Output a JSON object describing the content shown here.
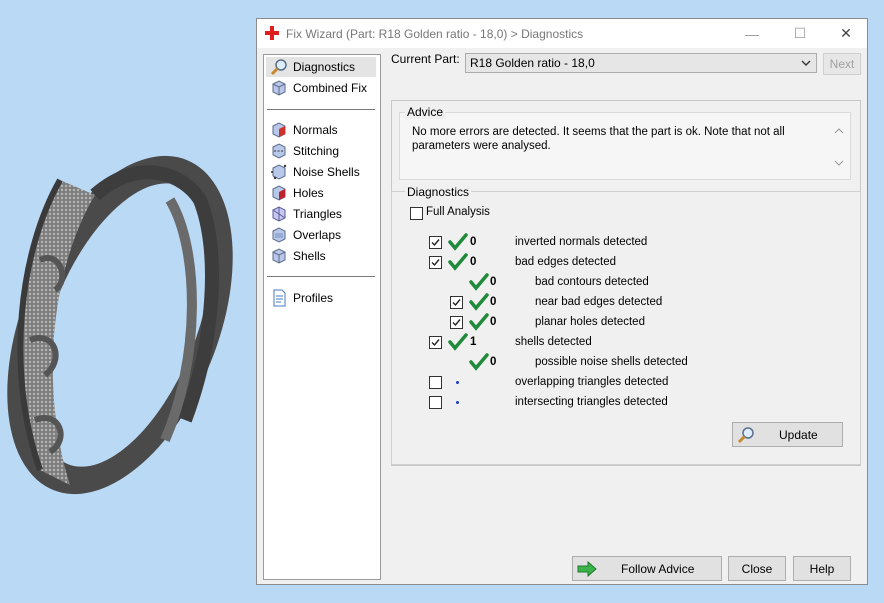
{
  "window": {
    "title": "Fix Wizard (Part: R18 Golden ratio - 18,0) > Diagnostics",
    "minimize": "—",
    "maximize": "☐",
    "close": "✕"
  },
  "sidebar": {
    "items": [
      {
        "label": "Diagnostics",
        "icon": "magnifier-icon"
      },
      {
        "label": "Combined Fix",
        "icon": "cube-icon"
      },
      {
        "label": "Normals",
        "icon": "normals-cube-icon"
      },
      {
        "label": "Stitching",
        "icon": "stitching-cube-icon"
      },
      {
        "label": "Noise Shells",
        "icon": "noise-shells-cube-icon"
      },
      {
        "label": "Holes",
        "icon": "holes-cube-icon"
      },
      {
        "label": "Triangles",
        "icon": "triangles-cube-icon"
      },
      {
        "label": "Overlaps",
        "icon": "overlaps-cube-icon"
      },
      {
        "label": "Shells",
        "icon": "shells-cube-icon"
      },
      {
        "label": "Profiles",
        "icon": "document-icon"
      }
    ]
  },
  "current_part": {
    "label": "Current Part:",
    "value": "R18 Golden ratio - 18,0",
    "next_label": "Next"
  },
  "advice": {
    "title": "Advice",
    "text": "No more errors are detected. It seems that the part is ok. Note that not all parameters were analysed."
  },
  "diagnostics": {
    "title": "Diagnostics",
    "full_analysis_label": "Full Analysis",
    "full_analysis_checked": false,
    "rows": [
      {
        "checkbox": true,
        "checked": true,
        "status": "ok",
        "count": "0",
        "text": "inverted normals detected",
        "indent": 0
      },
      {
        "checkbox": true,
        "checked": true,
        "status": "ok",
        "count": "0",
        "text": "bad edges detected",
        "indent": 0
      },
      {
        "checkbox": false,
        "checked": false,
        "status": "ok",
        "count": "0",
        "text": "bad contours detected",
        "indent": 1
      },
      {
        "checkbox": true,
        "checked": true,
        "status": "ok",
        "count": "0",
        "text": "near bad edges detected",
        "indent": 1
      },
      {
        "checkbox": true,
        "checked": true,
        "status": "ok",
        "count": "0",
        "text": "planar holes detected",
        "indent": 1
      },
      {
        "checkbox": true,
        "checked": true,
        "status": "ok",
        "count": "1",
        "text": "shells detected",
        "indent": 0
      },
      {
        "checkbox": false,
        "checked": false,
        "status": "ok",
        "count": "0",
        "text": "possible noise shells detected",
        "indent": 1
      },
      {
        "checkbox": true,
        "checked": false,
        "status": "pending",
        "count": "",
        "text": "overlapping triangles detected",
        "indent": 0
      },
      {
        "checkbox": true,
        "checked": false,
        "status": "pending",
        "count": "",
        "text": "intersecting triangles detected",
        "indent": 0
      }
    ],
    "update_label": "Update"
  },
  "footer": {
    "follow_advice_label": "Follow Advice",
    "close_label": "Close",
    "help_label": "Help"
  },
  "colors": {
    "background": "#b9d9f5",
    "check_green": "#1f8a3a",
    "pending_dot": "#1a3dbf"
  }
}
